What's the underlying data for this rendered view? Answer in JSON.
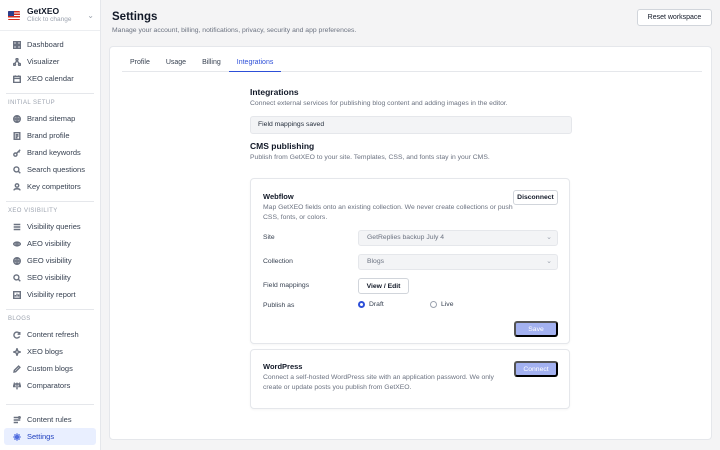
{
  "workspace": {
    "name": "GetXEO",
    "subtitle": "Click to change",
    "flag_icon": "us-flag-icon"
  },
  "sidebar": {
    "top_items": [
      {
        "label": "Dashboard",
        "icon": "dashboard-icon"
      },
      {
        "label": "Visualizer",
        "icon": "visualizer-icon"
      },
      {
        "label": "XEO calendar",
        "icon": "calendar-icon"
      }
    ],
    "sections": [
      {
        "title": "INITIAL SETUP",
        "items": [
          {
            "label": "Brand sitemap",
            "icon": "globe-icon"
          },
          {
            "label": "Brand profile",
            "icon": "document-icon"
          },
          {
            "label": "Brand keywords",
            "icon": "key-icon"
          },
          {
            "label": "Search questions",
            "icon": "search-icon"
          },
          {
            "label": "Key competitors",
            "icon": "user-icon"
          }
        ]
      },
      {
        "title": "XEO VISIBILITY",
        "items": [
          {
            "label": "Visibility queries",
            "icon": "list-icon"
          },
          {
            "label": "AEO visibility",
            "icon": "eye-icon"
          },
          {
            "label": "GEO visibility",
            "icon": "globe-icon"
          },
          {
            "label": "SEO visibility",
            "icon": "search-icon"
          },
          {
            "label": "Visibility report",
            "icon": "report-icon"
          }
        ]
      },
      {
        "title": "BLOGS",
        "items": [
          {
            "label": "Content refresh",
            "icon": "refresh-icon"
          },
          {
            "label": "XEO blogs",
            "icon": "blog-icon"
          },
          {
            "label": "Custom blogs",
            "icon": "edit-icon"
          },
          {
            "label": "Comparators",
            "icon": "compare-icon"
          }
        ]
      }
    ],
    "bottom_items": [
      {
        "label": "Content rules",
        "icon": "rules-icon"
      },
      {
        "label": "Settings",
        "icon": "gear-icon",
        "active": true
      }
    ]
  },
  "header": {
    "title": "Settings",
    "subtitle": "Manage your account, billing, notifications, privacy, security and app preferences.",
    "reset_label": "Reset workspace"
  },
  "tabs": [
    {
      "label": "Profile"
    },
    {
      "label": "Usage"
    },
    {
      "label": "Billing"
    },
    {
      "label": "Integrations",
      "active": true
    }
  ],
  "integrations": {
    "title": "Integrations",
    "description": "Connect external services for publishing blog content and adding images in the editor.",
    "status_message": "Field mappings saved",
    "cms_title": "CMS publishing",
    "cms_description": "Publish from GetXEO to your site. Templates, CSS, and fonts stay in your CMS."
  },
  "webflow": {
    "title": "Webflow",
    "description": "Map GetXEO fields onto an existing collection. We never create collections or push CSS, fonts, or colors.",
    "disconnect_label": "Disconnect",
    "site_label": "Site",
    "site_value": "GetReplies backup July 4",
    "collection_label": "Collection",
    "collection_value": "Blogs",
    "field_mappings_label": "Field mappings",
    "view_edit_label": "View / Edit",
    "publish_as_label": "Publish as",
    "publish_options": [
      "Draft",
      "Live"
    ],
    "publish_selected": "Draft",
    "save_label": "Save"
  },
  "wordpress": {
    "title": "WordPress",
    "description": "Connect a self-hosted WordPress site with an application password. We only create or update posts you publish from GetXEO.",
    "connect_label": "Connect"
  },
  "colors": {
    "accent": "#2d4fd8",
    "active_bg": "#e9efff",
    "disabled_button": "#a3b1f0"
  }
}
